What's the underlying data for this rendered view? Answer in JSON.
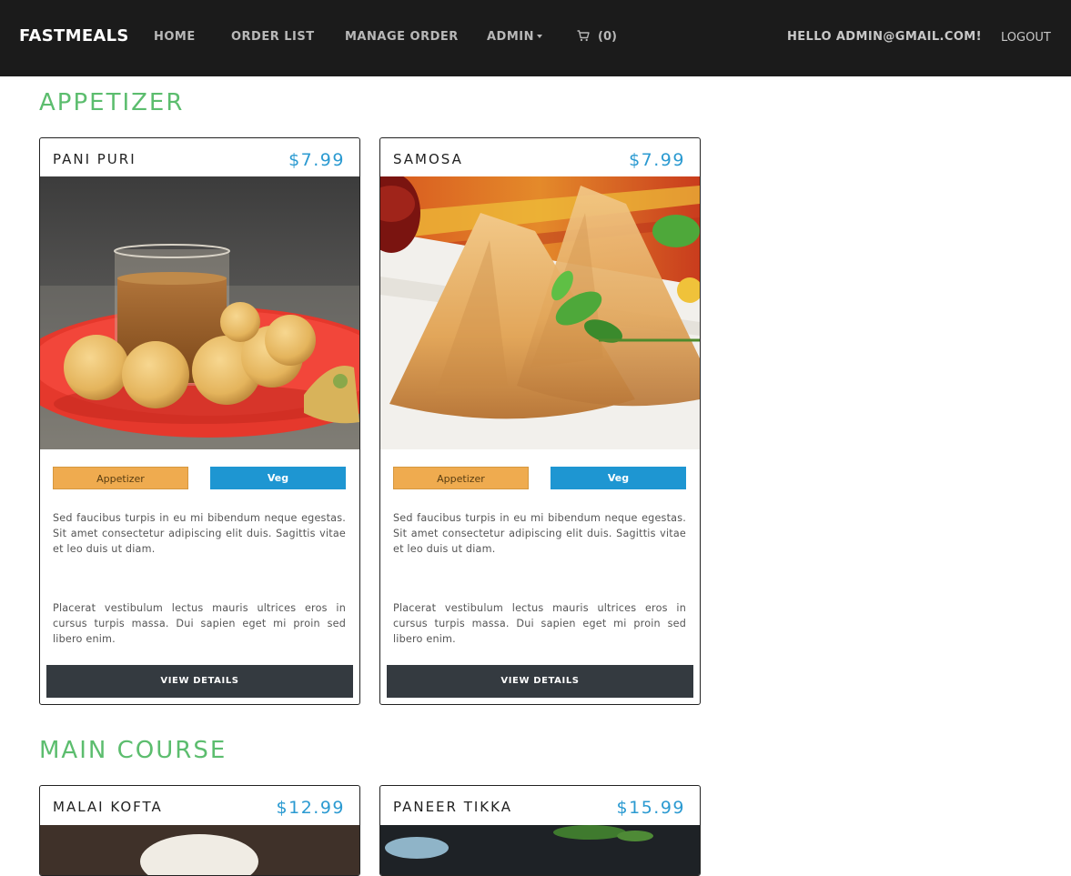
{
  "navbar": {
    "brand": "FASTMEALS",
    "links": {
      "home": "HOME",
      "order_list": "ORDER LIST",
      "manage_order": "MANAGE ORDER",
      "admin": "ADMIN"
    },
    "cart_count": "(0)",
    "greeting": "HELLO ADMIN@GMAIL.COM!",
    "logout": "LOGOUT"
  },
  "sections": {
    "appetizer": {
      "title": "APPETIZER",
      "items": [
        {
          "name": "PANI PURI",
          "price": "$7.99",
          "image": "pani-puri-photo",
          "category": "Appetizer",
          "diet": "Veg",
          "desc1": "Sed faucibus turpis in eu mi bibendum neque egestas. Sit amet consectetur adipiscing elit duis. Sagittis vitae et leo duis ut diam.",
          "desc2": "Placerat vestibulum lectus mauris ultrices eros in cursus turpis massa. Dui sapien eget mi proin sed libero enim.",
          "button": "VIEW DETAILS"
        },
        {
          "name": "SAMOSA",
          "price": "$7.99",
          "image": "samosa-photo",
          "category": "Appetizer",
          "diet": "Veg",
          "desc1": "Sed faucibus turpis in eu mi bibendum neque egestas. Sit amet consectetur adipiscing elit duis. Sagittis vitae et leo duis ut diam.",
          "desc2": "Placerat vestibulum lectus mauris ultrices eros in cursus turpis massa. Dui sapien eget mi proin sed libero enim.",
          "button": "VIEW DETAILS"
        }
      ]
    },
    "main_course": {
      "title": "MAIN COURSE",
      "items": [
        {
          "name": "MALAI KOFTA",
          "price": "$12.99",
          "image": "malai-kofta-photo"
        },
        {
          "name": "PANEER TIKKA",
          "price": "$15.99",
          "image": "paneer-tikka-photo"
        }
      ]
    }
  },
  "colors": {
    "navbar_bg": "#1b1b1b",
    "section_title": "#5cbd6e",
    "price": "#2b9ad1",
    "badge_category": "#efab4f",
    "badge_diet": "#1e96d2",
    "button_bg": "#343a40"
  },
  "icons": {
    "cart": "cart-icon",
    "admin_caret": "caret-down-icon"
  }
}
